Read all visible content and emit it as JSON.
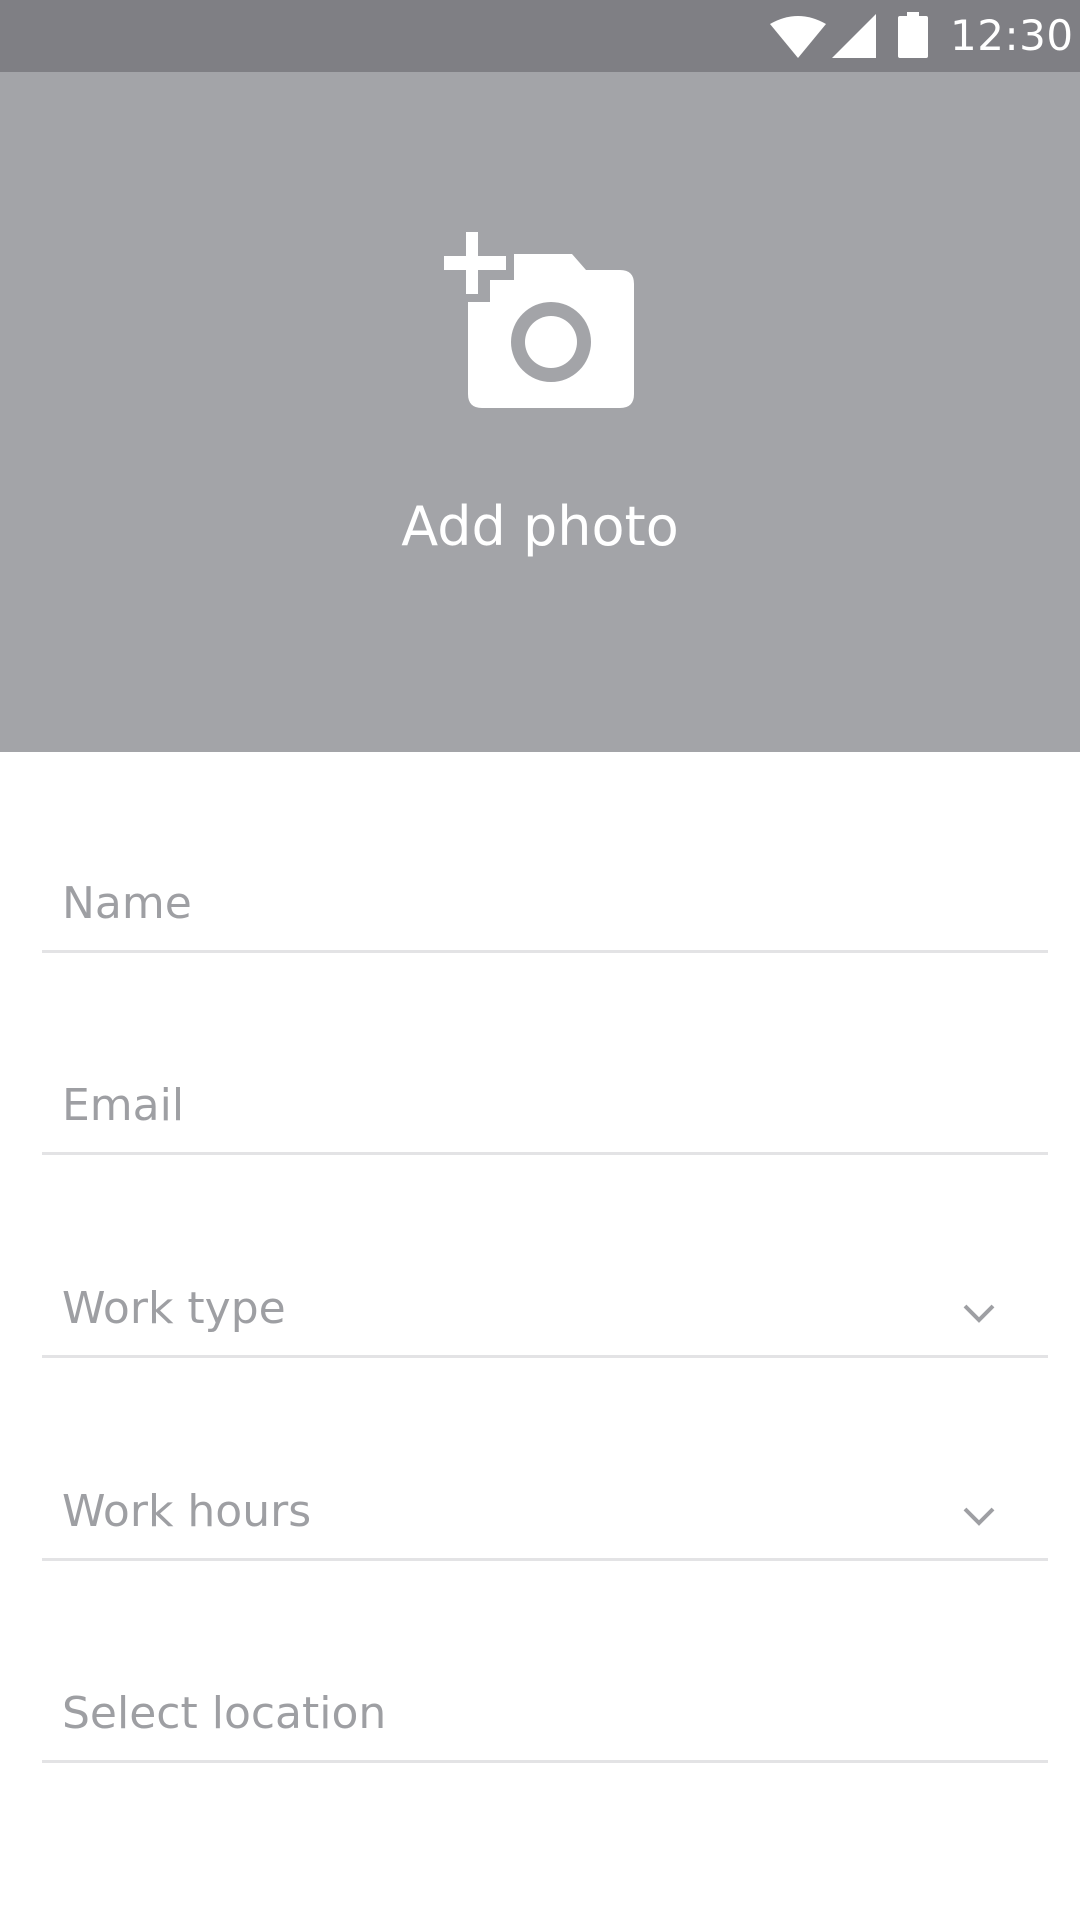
{
  "status_bar": {
    "time": "12:30",
    "icons": [
      "wifi-icon",
      "cell-signal-icon",
      "battery-icon"
    ],
    "background": "#7f7f84"
  },
  "header": {
    "icon": "add-photo-camera-icon",
    "label": "Add photo",
    "background": "#a3a4a8"
  },
  "form": {
    "name": {
      "placeholder": "Name",
      "value": ""
    },
    "email": {
      "placeholder": "Email",
      "value": ""
    },
    "work_type": {
      "placeholder": "Work type",
      "icon": "chevron-down-icon"
    },
    "work_hours": {
      "placeholder": "Work hours",
      "icon": "chevron-down-icon"
    },
    "location": {
      "placeholder": "Select location",
      "value": ""
    }
  },
  "colors": {
    "placeholder_text": "#9e9fa3",
    "divider": "#e3e3e5",
    "white": "#ffffff"
  }
}
